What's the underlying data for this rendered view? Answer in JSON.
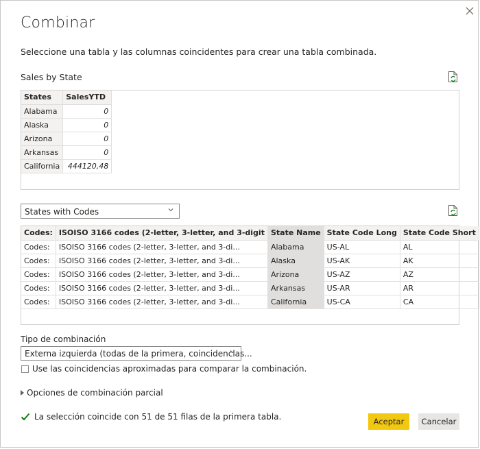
{
  "dialog": {
    "title": "Combinar",
    "subtitle": "Seleccione una tabla y las columnas coincidentes para crear una tabla combinada."
  },
  "table1": {
    "label": "Sales by State",
    "headers": [
      "States",
      "SalesYTD"
    ],
    "rows": [
      [
        "Alabama",
        "0"
      ],
      [
        "Alaska",
        "0"
      ],
      [
        "Arizona",
        "0"
      ],
      [
        "Arkansas",
        "0"
      ],
      [
        "California",
        "444120,48"
      ]
    ]
  },
  "table2": {
    "select_value": "States with Codes",
    "headers": [
      "Codes:",
      "ISOISO 3166 codes (2-letter, 3-letter, and 3-digit",
      "State Name",
      "State Code Long",
      "State Code Short"
    ],
    "rows": [
      [
        "Codes:",
        "ISOISO 3166 codes (2-letter, 3-letter, and 3-di...",
        "Alabama",
        "US-AL",
        "AL"
      ],
      [
        "Codes:",
        "ISOISO 3166 codes (2-letter, 3-letter, and 3-di...",
        "Alaska",
        "US-AK",
        "AK"
      ],
      [
        "Codes:",
        "ISOISO 3166 codes (2-letter, 3-letter, and 3-di...",
        "Arizona",
        "US-AZ",
        "AZ"
      ],
      [
        "Codes:",
        "ISOISO 3166 codes (2-letter, 3-letter, and 3-di...",
        "Arkansas",
        "US-AR",
        "AR"
      ],
      [
        "Codes:",
        "ISOISO 3166 codes (2-letter, 3-letter, and 3-di...",
        "California",
        "US-CA",
        "CA"
      ]
    ]
  },
  "join": {
    "label": "Tipo de combinación",
    "value": "Externa izquierda (todas de la primera, coincidencias...",
    "fuzzy_label": "Use las coincidencias aproximadas para comparar la combinación.",
    "fuzzy_checked": false,
    "partial_label": "Opciones de combinación parcial"
  },
  "status": {
    "text": "La selección coincide con 51 de 51 filas de la primera tabla.",
    "icon": "checkmark-icon",
    "color": "#107c10"
  },
  "buttons": {
    "ok": "Aceptar",
    "cancel": "Cancelar"
  },
  "colors": {
    "accent": "#f2c811",
    "selected_column": "#e1dfdd"
  }
}
